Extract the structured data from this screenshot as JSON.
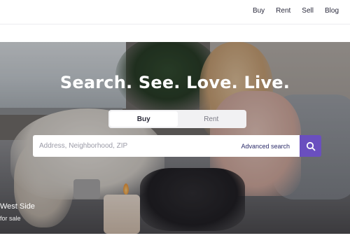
{
  "nav": {
    "items": [
      {
        "label": "Buy"
      },
      {
        "label": "Rent"
      },
      {
        "label": "Sell"
      },
      {
        "label": "Blog"
      }
    ]
  },
  "hero": {
    "headline": "Search. See. Love. Live.",
    "tabs": [
      {
        "label": "Buy",
        "active": true
      },
      {
        "label": "Rent",
        "active": false
      }
    ],
    "search": {
      "placeholder": "Address, Neighborhood, ZIP",
      "value": "",
      "advanced_label": "Advanced search",
      "button_icon": "search-icon"
    },
    "location": {
      "title": "West Side",
      "subtitle": "for sale"
    }
  },
  "colors": {
    "accent": "#6a4fbf",
    "text": "#2b2b3a"
  }
}
